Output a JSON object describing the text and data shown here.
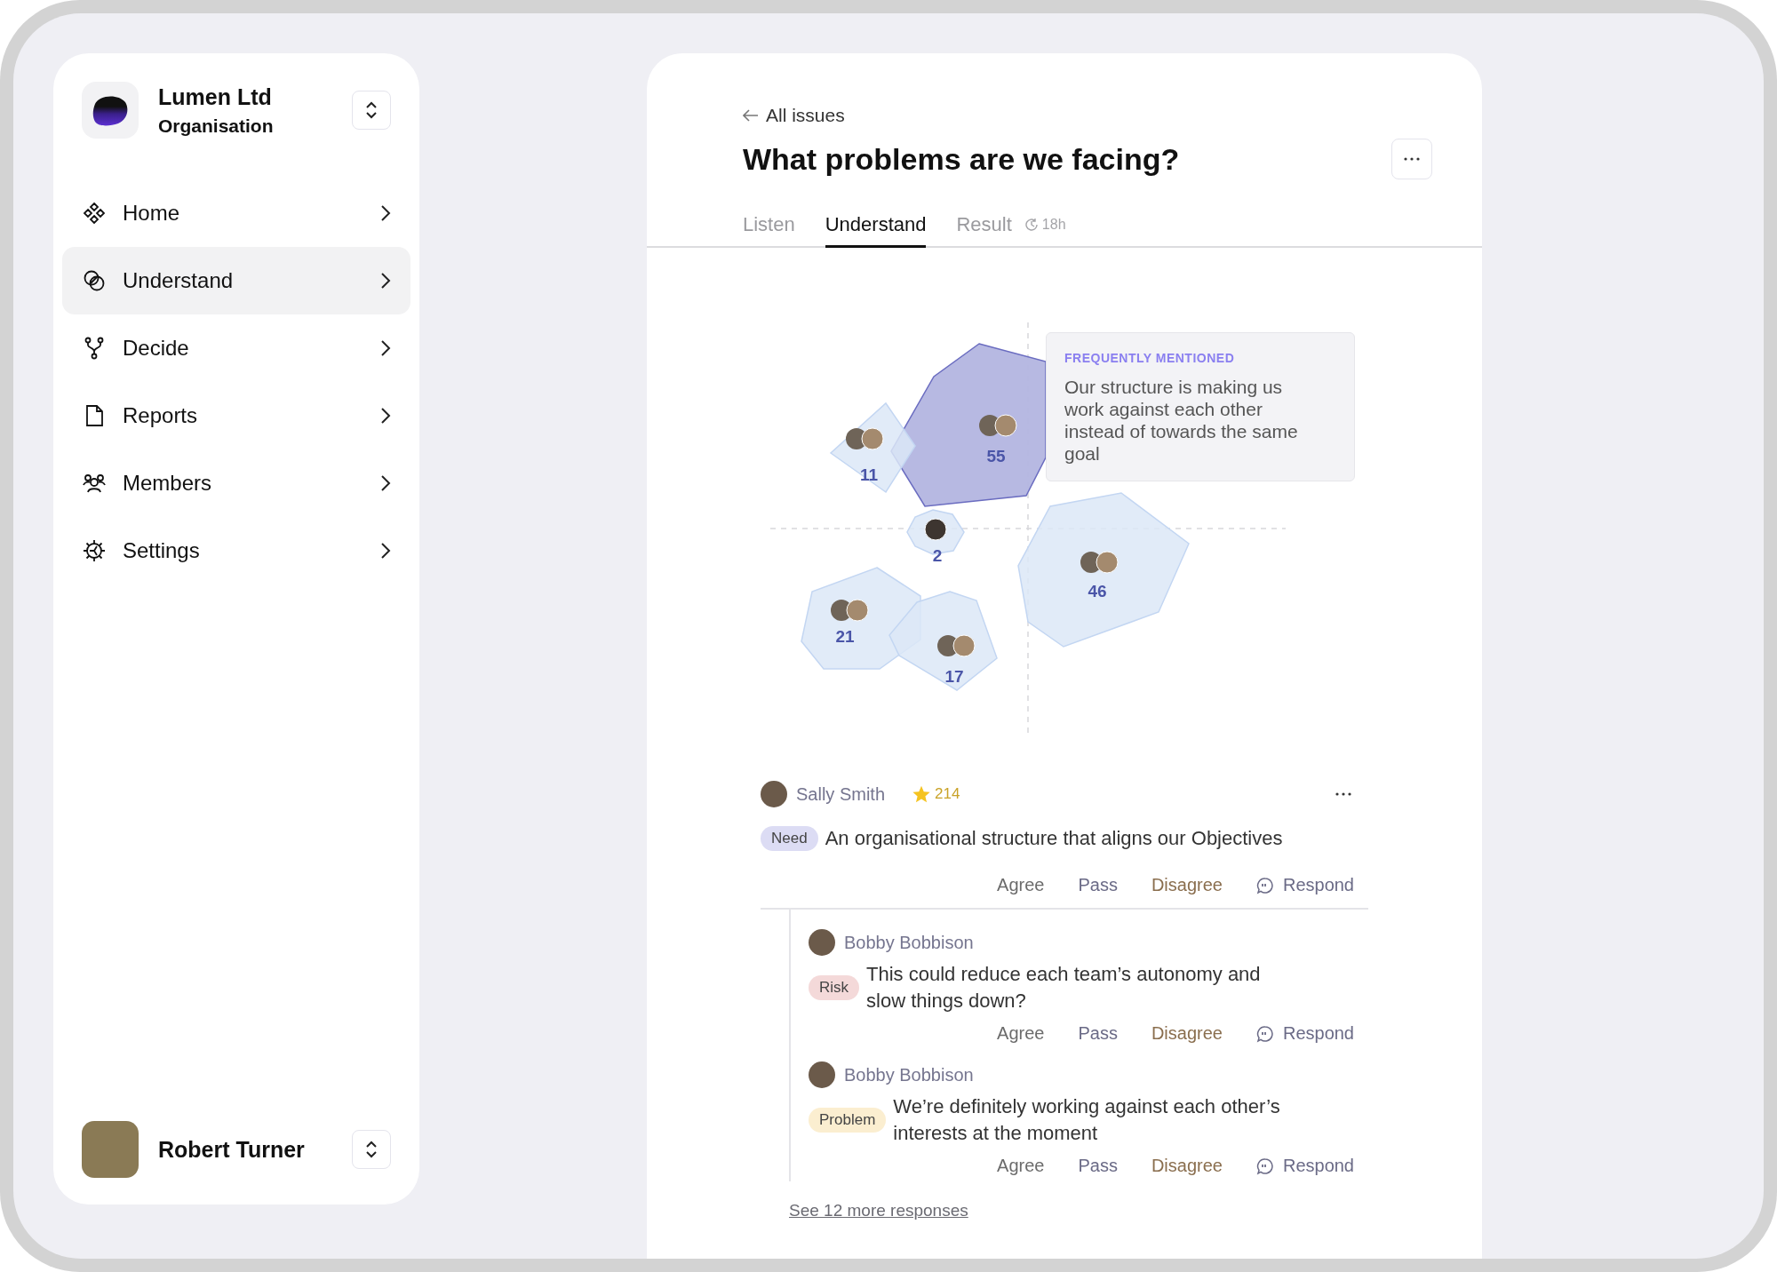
{
  "sidebar": {
    "organisation": {
      "name": "Lumen Ltd",
      "role": "Organisation"
    },
    "nav_items": [
      {
        "label": "Home",
        "kind": "home",
        "selected": false
      },
      {
        "label": "Understand",
        "kind": "understand",
        "selected": true
      },
      {
        "label": "Decide",
        "kind": "decide",
        "selected": false
      },
      {
        "label": "Reports",
        "kind": "reports",
        "selected": false
      },
      {
        "label": "Members",
        "kind": "members",
        "selected": false
      },
      {
        "label": "Settings",
        "kind": "settings",
        "selected": false
      }
    ],
    "user": {
      "name": "Robert Turner"
    }
  },
  "main": {
    "back_link": "All issues",
    "title": "What problems are we facing?",
    "tabs": [
      {
        "label": "Listen",
        "selected": false
      },
      {
        "label": "Understand",
        "selected": true
      },
      {
        "label": "Result",
        "selected": false,
        "timer": "18h"
      }
    ],
    "cluster_map": {
      "clusters": [
        {
          "count": "11",
          "highlighted": false
        },
        {
          "count": "55",
          "highlighted": true
        },
        {
          "count": "2",
          "highlighted": false
        },
        {
          "count": "46",
          "highlighted": false
        },
        {
          "count": "21",
          "highlighted": false
        },
        {
          "count": "17",
          "highlighted": false
        }
      ],
      "tooltip": {
        "heading": "FREQUENTLY MENTIONED",
        "text": "Our structure is making us work against each other instead of towards the same goal"
      }
    },
    "post": {
      "author": "Sally Smith",
      "score": "214",
      "tag": {
        "label": "Need",
        "kind": "need"
      },
      "text": "An organisational structure that aligns our Objectives",
      "actions": [
        {
          "label": "Agree",
          "kind": "agree"
        },
        {
          "label": "Pass",
          "kind": "pass"
        },
        {
          "label": "Disagree",
          "kind": "disagree"
        },
        {
          "label": "Respond",
          "kind": "respond"
        }
      ]
    },
    "replies": [
      {
        "author": "Bobby Bobbison",
        "tag": {
          "label": "Risk",
          "kind": "risk"
        },
        "text": "This could reduce each team’s autonomy and slow things down?",
        "actions": [
          {
            "label": "Agree",
            "kind": "agree"
          },
          {
            "label": "Pass",
            "kind": "pass"
          },
          {
            "label": "Disagree",
            "kind": "disagree"
          },
          {
            "label": "Respond",
            "kind": "respond"
          }
        ]
      },
      {
        "author": "Bobby Bobbison",
        "tag": {
          "label": "Problem",
          "kind": "problem"
        },
        "text": "We’re definitely working against each other’s interests at the moment",
        "actions": [
          {
            "label": "Agree",
            "kind": "agree"
          },
          {
            "label": "Pass",
            "kind": "pass"
          },
          {
            "label": "Disagree",
            "kind": "disagree"
          },
          {
            "label": "Respond",
            "kind": "respond"
          }
        ]
      }
    ],
    "more_link": "See 12 more responses"
  }
}
